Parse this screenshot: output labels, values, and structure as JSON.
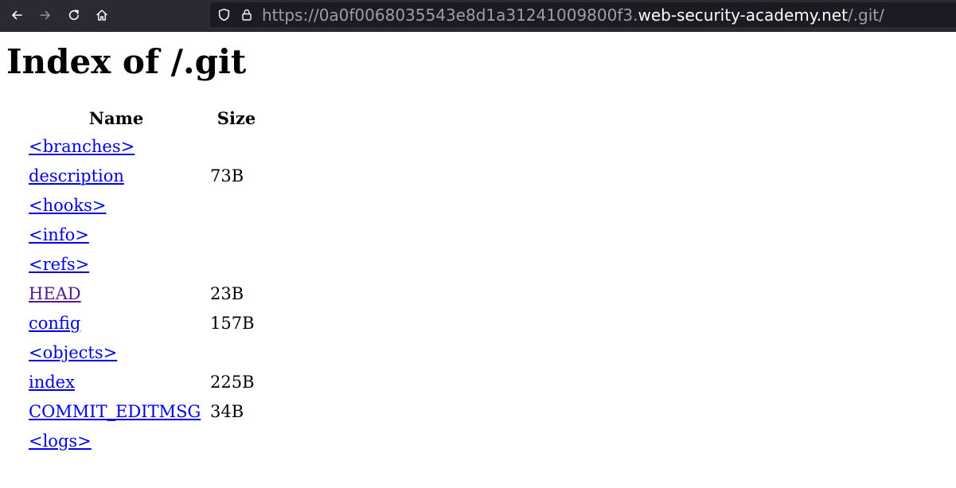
{
  "browser": {
    "url": {
      "prefix": "https://0a0f0068035543e8d1a31241009800f3.",
      "host": "web-security-academy.net",
      "path": "/.git/"
    },
    "icons": {
      "back": "arrow-left-icon",
      "forward": "arrow-right-icon",
      "reload": "reload-icon",
      "home": "home-icon",
      "tracking": "shield-icon",
      "secure": "lock-icon"
    }
  },
  "page": {
    "title": "Index of /.git",
    "columns": {
      "name": "Name",
      "size": "Size"
    },
    "entries": [
      {
        "name": "<branches>",
        "size": ""
      },
      {
        "name": "description",
        "size": "73B"
      },
      {
        "name": "<hooks>",
        "size": ""
      },
      {
        "name": "<info>",
        "size": ""
      },
      {
        "name": "<refs>",
        "size": ""
      },
      {
        "name": "HEAD",
        "size": "23B"
      },
      {
        "name": "config",
        "size": "157B"
      },
      {
        "name": "<objects>",
        "size": ""
      },
      {
        "name": "index",
        "size": "225B"
      },
      {
        "name": "COMMIT_EDITMSG",
        "size": "34B"
      },
      {
        "name": "<logs>",
        "size": ""
      }
    ]
  },
  "colors": {
    "link": "#0000ee",
    "visited_link": "#551a8b",
    "toolbar": "#2b2a33",
    "urlbar": "#1c1b22"
  }
}
